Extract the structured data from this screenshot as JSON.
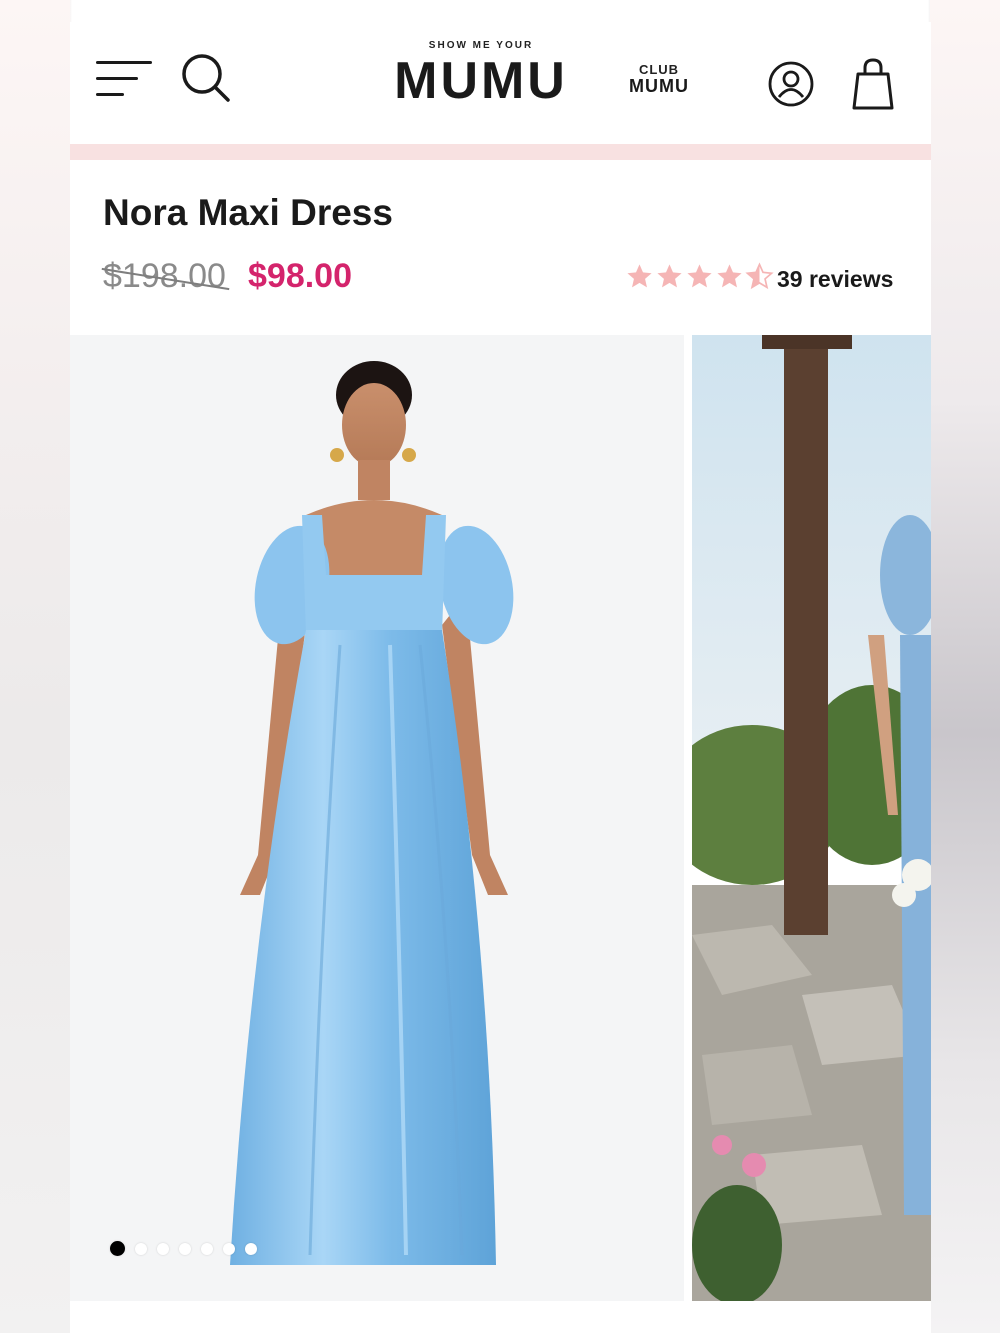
{
  "header": {
    "logo_small": "SHOW ME YOUR",
    "logo_big": "MUMU",
    "club_top": "CLUB",
    "club_bottom": "MUMU"
  },
  "product": {
    "title": "Nora Maxi Dress",
    "original_price": "$198.00",
    "sale_price": "$98.00",
    "rating": 4.5,
    "rating_max": 5,
    "reviews_label": "39 reviews"
  },
  "gallery": {
    "image_count": 7,
    "active_index": 0
  },
  "colors": {
    "sale_price": "#d4246c",
    "star": "#f5b5b5",
    "pink_bar": "#f8e1e1",
    "dress": "#8cc4ee"
  },
  "icons": [
    "menu-icon",
    "search-icon",
    "account-icon",
    "shopping-bag-icon",
    "star-icon"
  ]
}
